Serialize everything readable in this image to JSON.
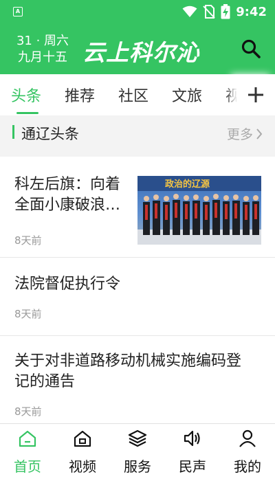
{
  "statusbar": {
    "time": "9:42",
    "app_badge": "A"
  },
  "header": {
    "date_line1": "31 · 周六",
    "date_line2": "九月十五",
    "logo": "云上科尔沁"
  },
  "tabs": [
    {
      "label": "头条",
      "active": true
    },
    {
      "label": "推荐"
    },
    {
      "label": "社区"
    },
    {
      "label": "文旅"
    },
    {
      "label": "视"
    }
  ],
  "section": {
    "title": "通辽头条",
    "more": "更多"
  },
  "items": [
    {
      "title_line1": "科左后旗：向着",
      "title_line2": "全面小康破浪…",
      "time": "8天前"
    },
    {
      "title_line1": "法院督促执行令",
      "time": "8天前"
    },
    {
      "title_line1": "关于对非道路移动机械实施编码登",
      "title_line2": "记的通告",
      "time": "8天前"
    }
  ],
  "bottomnav": [
    {
      "label": "首页",
      "icon": "home-icon",
      "active": true
    },
    {
      "label": "视频",
      "icon": "video-home-icon"
    },
    {
      "label": "服务",
      "icon": "layers-icon"
    },
    {
      "label": "民声",
      "icon": "speaker-icon"
    },
    {
      "label": "我的",
      "icon": "person-icon"
    }
  ],
  "colors": {
    "accent": "#35c462"
  }
}
